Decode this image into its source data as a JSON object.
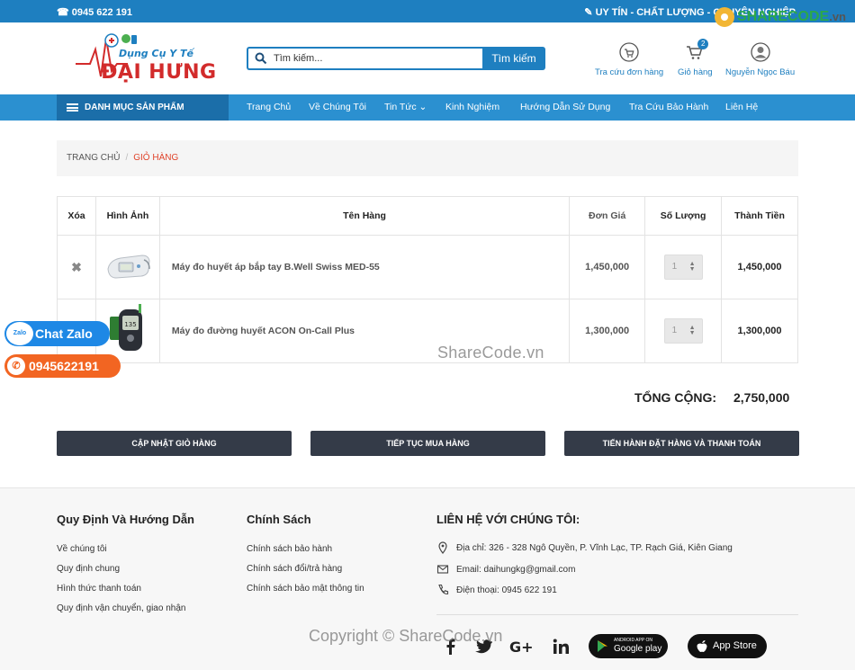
{
  "topbar": {
    "phone": "☎ 0945 622 191",
    "slogan": "✎ UY TÍN - CHẤT LƯỢNG - CHUYÊN NGHIỆP"
  },
  "brand": {
    "tagline": "Dụng Cụ Y Tế",
    "name": "ĐẠI HƯNG"
  },
  "search": {
    "placeholder": "Tìm kiếm...",
    "button": "Tìm kiếm"
  },
  "header_links": {
    "order_lookup": "Tra cứu đơn hàng",
    "cart": "Giỏ hàng",
    "cart_count": "2",
    "user": "Nguyễn Ngọc Báu"
  },
  "nav": {
    "category": "DANH MỤC SẢN PHẨM",
    "items": [
      "Trang Chủ",
      "Về Chúng Tôi",
      "Tin Tức ⌄",
      "Kinh Nghiệm",
      "Hướng Dẫn Sử Dụng",
      "Tra Cứu Bảo Hành",
      "Liên Hệ"
    ]
  },
  "breadcrumb": {
    "home": "TRANG CHỦ",
    "separator": "/",
    "current": "GIỎ HÀNG"
  },
  "cart_table": {
    "headers": {
      "remove": "Xóa",
      "image": "Hình Ảnh",
      "name": "Tên Hàng",
      "price": "Đơn Giá",
      "qty": "Số Lượng",
      "total": "Thành Tiền"
    },
    "rows": [
      {
        "remove": "✖",
        "name": "Máy đo huyết áp bắp tay B.Well Swiss MED-55",
        "price": "1,450,000",
        "qty": "1",
        "total": "1,450,000"
      },
      {
        "remove": "✖",
        "name": "Máy đo đường huyết ACON On-Call Plus",
        "price": "1,300,000",
        "qty": "1",
        "total": "1,300,000"
      }
    ],
    "meter_reading": "135"
  },
  "summary": {
    "label": "TỔNG CỘNG:",
    "value": "2,750,000"
  },
  "actions": {
    "update": "CẬP NHẬT GIỎ HÀNG",
    "continue": "TIẾP TỤC MUA HÀNG",
    "checkout": "TIẾN HÀNH ĐẶT HÀNG VÀ THANH TOÁN"
  },
  "footer": {
    "col1": {
      "title": "Quy Định Và Hướng Dẫn",
      "links": [
        "Về chúng tôi",
        "Quy định chung",
        "Hình thức thanh toán",
        "Quy định vận chuyển, giao nhận"
      ]
    },
    "col2": {
      "title": "Chính Sách",
      "links": [
        "Chính sách bảo hành",
        "Chính sách đổi/trả hàng",
        "Chính sách bảo mật thông tin"
      ]
    },
    "col3": {
      "title": "LIÊN HỆ VỚI CHÚNG TÔI:",
      "address": "Địa chỉ: 326 - 328 Ngô Quyền, P. Vĩnh Lạc, TP. Rạch Giá, Kiên Giang",
      "email": "Email: daihungkg@gmail.com",
      "phone": "Điện thoại: 0945 622 191"
    },
    "stores": {
      "google_small": "ANDROID APP ON",
      "google_big": "Google play",
      "apple_big": "App Store"
    }
  },
  "floating": {
    "zalo_icon": "Zalo",
    "zalo": "Chat Zalo",
    "hotline": "0945622191"
  },
  "watermarks": {
    "logo_share": "SHARE",
    "logo_code": "CODE",
    "logo_vn": ".vn",
    "middle": "ShareCode.vn",
    "bottom": "Copyright © ShareCode.vn"
  },
  "colors": {
    "primary": "#1e7fc0",
    "nav": "#2b90d0",
    "nav_category": "#1b6ea9",
    "brand_red": "#d22b2b",
    "button_dark": "#343b48",
    "breadcrumb_active": "#e0442b",
    "zalo": "#1e88e5",
    "hotline": "#f26522"
  },
  "icons": {
    "search": "search-icon",
    "order_lookup": "cart-search-icon",
    "cart": "shopping-cart-icon",
    "user": "user-avatar-icon",
    "menu": "hamburger-menu-icon",
    "location": "map-pin-icon",
    "email": "envelope-icon",
    "phone": "phone-icon",
    "facebook": "facebook-icon",
    "twitter": "twitter-icon",
    "google_plus": "google-plus-icon",
    "linkedin": "linkedin-icon"
  }
}
